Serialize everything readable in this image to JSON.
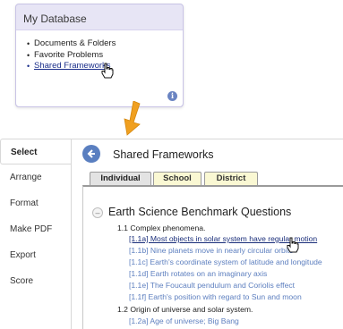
{
  "database": {
    "title": "My Database",
    "items": [
      "Documents & Folders",
      "Favorite Problems",
      "Shared Frameworks"
    ]
  },
  "sidebar": {
    "items": [
      {
        "label": "Select"
      },
      {
        "label": "Arrange"
      },
      {
        "label": "Format"
      },
      {
        "label": "Make PDF"
      },
      {
        "label": "Export"
      },
      {
        "label": "Score"
      }
    ]
  },
  "panel": {
    "title": "Shared Frameworks",
    "tabs": [
      "Individual",
      "School",
      "District"
    ]
  },
  "framework": {
    "title": "Earth Science Benchmark Questions",
    "groups": [
      {
        "heading": "1.1 Complex phenomena.",
        "items": [
          "[1.1a] Most objects in solar system have regular motion",
          "[1.1b] Nine planets move in nearly circular orbits",
          "[1.1c] Earth's coordinate system of latitude and longitude",
          "[1.1d] Earth rotates on an imaginary axis",
          "[1.1e] The Foucault pendulum and Coriolis effect",
          "[1.1f] Earth's position with regard to Sun and moon"
        ]
      },
      {
        "heading": "1.2 Origin of universe and solar system.",
        "items": [
          "[1.2a] Age of universe; Big Bang"
        ]
      }
    ]
  },
  "colors": {
    "card_bg": "#e7e5f5",
    "accent_blue": "#5a7fc0",
    "link_blue": "#5d7fbf",
    "arrow_orange": "#f0a020",
    "tab_yellow": "#faf8d3"
  }
}
